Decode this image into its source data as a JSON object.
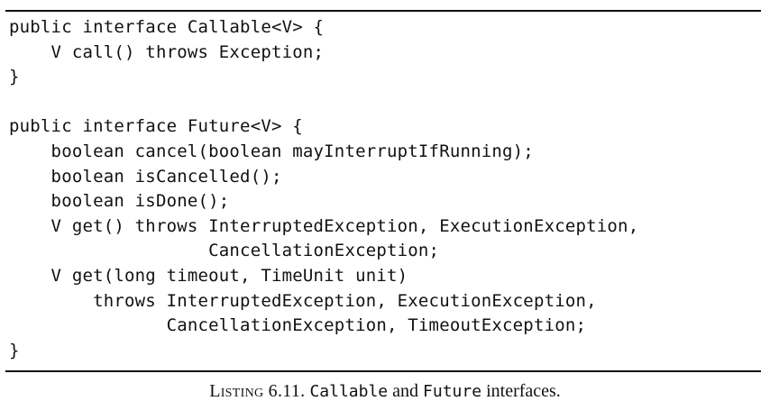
{
  "listing": {
    "code_lines": [
      "public interface Callable<V> {",
      "    V call() throws Exception;",
      "}",
      "",
      "public interface Future<V> {",
      "    boolean cancel(boolean mayInterruptIfRunning);",
      "    boolean isCancelled();",
      "    boolean isDone();",
      "    V get() throws InterruptedException, ExecutionException,",
      "                   CancellationException;",
      "    V get(long timeout, TimeUnit unit)",
      "        throws InterruptedException, ExecutionException,",
      "               CancellationException, TimeoutException;",
      "}"
    ]
  },
  "caption": {
    "label": "Listing 6.11.",
    "term1": "Callable",
    "conjunction": "and",
    "term2": "Future",
    "tail": "interfaces."
  }
}
